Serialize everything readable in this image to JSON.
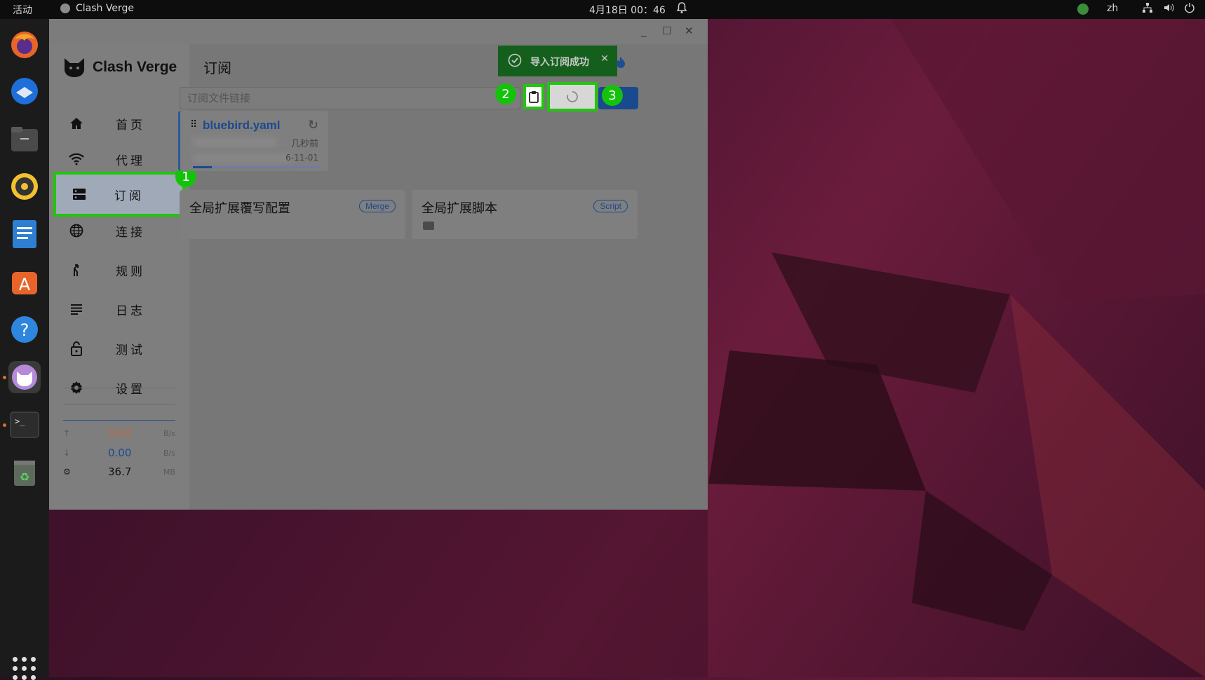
{
  "topbar": {
    "activities": "活动",
    "app_name": "Clash Verge",
    "clock": "4月18日  00：46",
    "lang": "zh"
  },
  "window": {
    "brand": "Clash Verge",
    "nav": [
      {
        "label": "首页",
        "icon": "home-icon"
      },
      {
        "label": "代理",
        "icon": "wifi-icon"
      },
      {
        "label": "订阅",
        "icon": "storage-icon",
        "active": true
      },
      {
        "label": "连接",
        "icon": "globe-icon"
      },
      {
        "label": "规则",
        "icon": "fork-icon"
      },
      {
        "label": "日志",
        "icon": "list-icon"
      },
      {
        "label": "测试",
        "icon": "lock-icon"
      },
      {
        "label": "设置",
        "icon": "gear-icon"
      }
    ],
    "stats": {
      "upload_value": "0.00",
      "upload_unit": "B/s",
      "download_value": "0.00",
      "download_unit": "B/s",
      "memory_value": "36.7",
      "memory_unit": "MB"
    },
    "page_title": "订阅",
    "toast": {
      "text": "导入订阅成功"
    },
    "url_input": {
      "placeholder": "订阅文件链接",
      "value": ""
    },
    "profile": {
      "name": "bluebird.yaml",
      "updated": "几秒前",
      "expire": "6-11-01",
      "progress": 0.15
    },
    "ext_cards": [
      {
        "title": "全局扩展覆写配置",
        "tag": "Merge"
      },
      {
        "title": "全局扩展脚本",
        "tag": "Script"
      }
    ],
    "annotations": [
      "1",
      "2",
      "3"
    ]
  },
  "colors": {
    "highlight": "#22c50f",
    "accent": "#1b4a8f",
    "toast_bg": "#155f1c",
    "upload": "#c06a3a"
  }
}
